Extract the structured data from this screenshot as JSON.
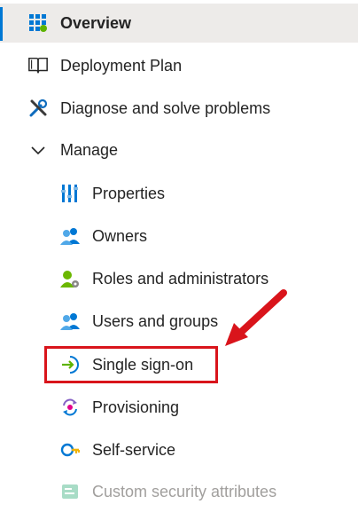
{
  "nav": {
    "overview": {
      "label": "Overview",
      "icon": "overview-grid-icon"
    },
    "deployment_plan": {
      "label": "Deployment Plan",
      "icon": "book-icon"
    },
    "diagnose": {
      "label": "Diagnose and solve problems",
      "icon": "wrench-icon"
    },
    "manage": {
      "label": "Manage",
      "icon": "chevron-down-icon"
    },
    "children": [
      {
        "label": "Properties",
        "icon": "properties-icon"
      },
      {
        "label": "Owners",
        "icon": "users-icon"
      },
      {
        "label": "Roles and administrators",
        "icon": "user-admin-icon"
      },
      {
        "label": "Users and groups",
        "icon": "users-icon"
      },
      {
        "label": "Single sign-on",
        "icon": "sign-in-arrow-icon"
      },
      {
        "label": "Provisioning",
        "icon": "provisioning-icon"
      },
      {
        "label": "Self-service",
        "icon": "key-icon"
      },
      {
        "label": "Custom security attributes",
        "icon": "attributes-icon"
      }
    ]
  },
  "colors": {
    "accent": "#0078d4",
    "selected_bg": "#edebe9",
    "annotation_red": "#d9141b",
    "disabled_text": "#a19f9d"
  }
}
